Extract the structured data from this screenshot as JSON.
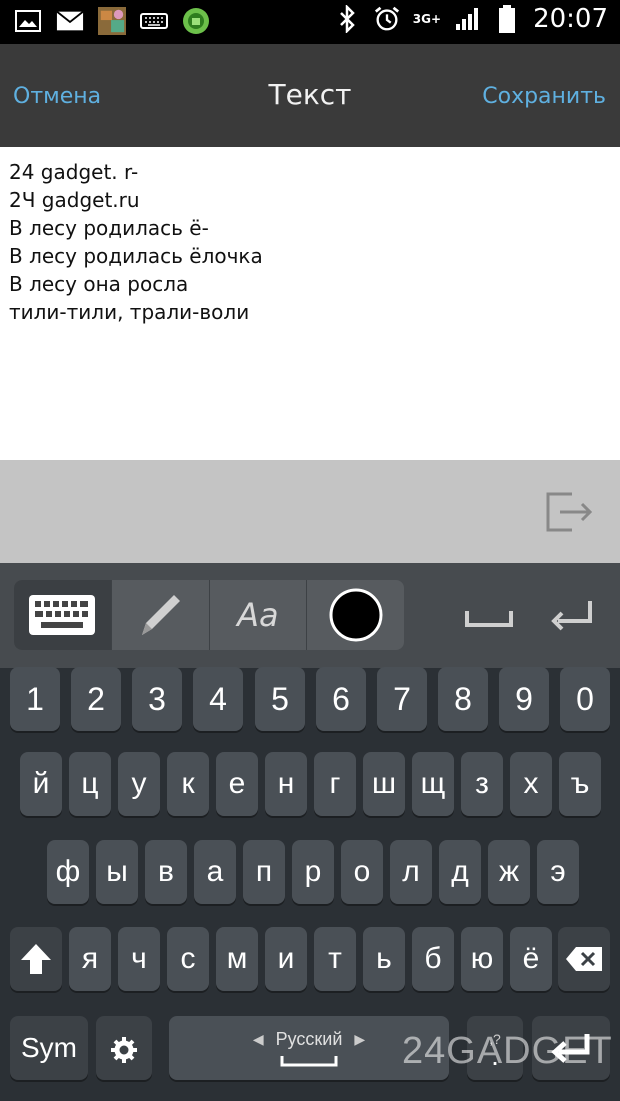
{
  "status_bar": {
    "time": "20:07",
    "network": "3G+",
    "icons": [
      "picture-icon",
      "mail-icon",
      "app-thumbnail-icon",
      "keyboard-icon",
      "android-shield-icon",
      "bluetooth-icon",
      "alarm-icon",
      "signal-icon",
      "battery-icon"
    ]
  },
  "action_bar": {
    "cancel_label": "Отмена",
    "title": "Текст",
    "save_label": "Сохранить"
  },
  "editor": {
    "lines": [
      "24 gadget. r-",
      "2Ч gadget.ru",
      "В лесу родилась ё-",
      "В лесу родилась ёлочка",
      "В лесу она росла",
      "тили-тили, трали-воли"
    ]
  },
  "keyboard": {
    "mode_label": "Aa",
    "number_row": [
      "1",
      "2",
      "3",
      "4",
      "5",
      "6",
      "7",
      "8",
      "9",
      "0"
    ],
    "row1": [
      "й",
      "ц",
      "у",
      "к",
      "е",
      "н",
      "г",
      "ш",
      "щ",
      "з",
      "х",
      "ъ"
    ],
    "row2": [
      "ф",
      "ы",
      "в",
      "а",
      "п",
      "р",
      "о",
      "л",
      "д",
      "ж",
      "э"
    ],
    "row3": [
      "я",
      "ч",
      "с",
      "м",
      "и",
      "т",
      "ь",
      "б",
      "ю",
      "ё"
    ],
    "sym_label": "Sym",
    "language": "Русский",
    "punct_label": ".",
    "punct_hint": ",?"
  },
  "watermark": "24GADGET",
  "colors": {
    "accent": "#5fb0e0",
    "action_bar": "#3a3a3a",
    "keyboard_bg": "#2b3035",
    "key_bg": "#4a5056"
  }
}
